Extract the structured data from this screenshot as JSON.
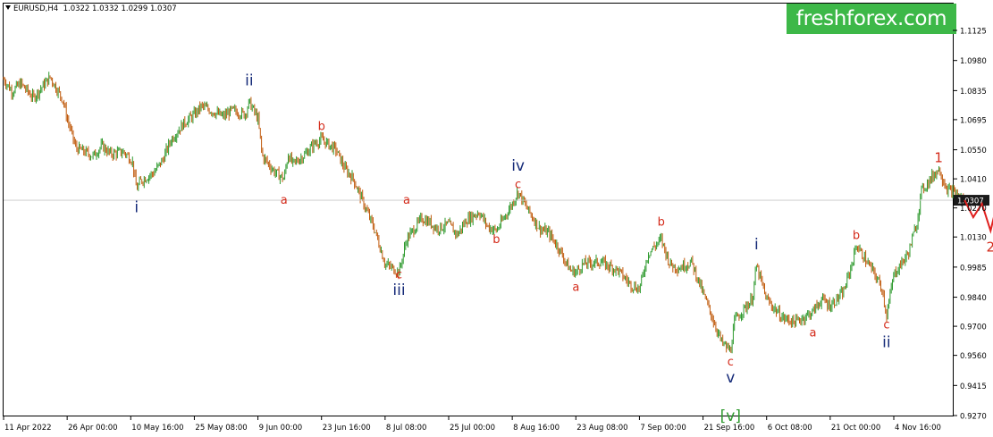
{
  "header": {
    "symbol": "EURUSD,H4",
    "ohlc": [
      "1.0322",
      "1.0332",
      "1.0299",
      "1.0307"
    ]
  },
  "brand": {
    "logo_text": "freshforex.com",
    "logo_bg": "#3db848"
  },
  "colors": {
    "bull_candle": "#2e9a2e",
    "bear_candle": "#c05a0c",
    "wave_label_red": "#d42a1a",
    "wave_label_blue": "#152a78",
    "forecast_line": "#e0201e",
    "price_tag_bg": "#1a1a1a"
  },
  "chart_data": {
    "type": "candlestick",
    "instrument": "EURUSD",
    "timeframe": "H4",
    "current_price": 1.0307,
    "current_price_label": "1.0307",
    "ylim": [
      0.9255,
      1.12
    ],
    "y_ticks": [
      {
        "value": 1.1125,
        "label": "1.1125"
      },
      {
        "value": 1.098,
        "label": "1.0980"
      },
      {
        "value": 1.0835,
        "label": "1.0835"
      },
      {
        "value": 1.0695,
        "label": "1.0695"
      },
      {
        "value": 1.055,
        "label": "1.0550"
      },
      {
        "value": 1.041,
        "label": "1.0410"
      },
      {
        "value": 1.027,
        "label": "1.0270"
      },
      {
        "value": 1.013,
        "label": "1.0130"
      },
      {
        "value": 0.9985,
        "label": "0.9985"
      },
      {
        "value": 0.984,
        "label": "0.9840"
      },
      {
        "value": 0.97,
        "label": "0.9700"
      },
      {
        "value": 0.956,
        "label": "0.9560"
      },
      {
        "value": 0.9415,
        "label": "0.9415"
      },
      {
        "value": 0.927,
        "label": "0.9270"
      }
    ],
    "x_ticks": [
      "11 Apr 2022",
      "26 Apr 00:00",
      "10 May 16:00",
      "25 May 08:00",
      "9 Jun 00:00",
      "23 Jun 16:00",
      "8 Jul 08:00",
      "25 Jul 00:00",
      "8 Aug 16:00",
      "23 Aug 08:00",
      "7 Sep 00:00",
      "21 Sep 16:00",
      "6 Oct 08:00",
      "21 Oct 00:00",
      "4 Nov 16:00"
    ],
    "price_path": [
      [
        "11 Apr 2022",
        1.089
      ],
      [
        "13 Apr",
        1.083
      ],
      [
        "15 Apr",
        1.087
      ],
      [
        "18 Apr",
        1.08
      ],
      [
        "20 Apr",
        1.085
      ],
      [
        "22 Apr",
        1.09
      ],
      [
        "25 Apr",
        1.079
      ],
      [
        "26 Apr 00:00",
        1.07
      ],
      [
        "28 Apr",
        1.056
      ],
      [
        "2 May",
        1.052
      ],
      [
        "4 May",
        1.057
      ],
      [
        "6 May",
        1.053
      ],
      [
        "9 May",
        1.054
      ],
      [
        "11 May",
        1.05
      ],
      [
        "12 May",
        1.036
      ],
      [
        "13 May",
        1.04
      ],
      [
        "16 May",
        1.044
      ],
      [
        "18 May",
        1.05
      ],
      [
        "20 May",
        1.06
      ],
      [
        "23 May",
        1.068
      ],
      [
        "25 May 08:00",
        1.072
      ],
      [
        "27 May",
        1.076
      ],
      [
        "30 May",
        1.073
      ],
      [
        "1 Jun",
        1.071
      ],
      [
        "3 Jun",
        1.074
      ],
      [
        "6 Jun",
        1.072
      ],
      [
        "7 Jun",
        1.078
      ],
      [
        "9 Jun 00:00",
        1.07
      ],
      [
        "10 Jun",
        1.052
      ],
      [
        "13 Jun",
        1.044
      ],
      [
        "15 Jun",
        1.041
      ],
      [
        "16 Jun",
        1.053
      ],
      [
        "17 Jun",
        1.048
      ],
      [
        "20 Jun",
        1.053
      ],
      [
        "22 Jun",
        1.058
      ],
      [
        "23 Jun 16:00",
        1.06
      ],
      [
        "27 Jun",
        1.055
      ],
      [
        "29 Jun",
        1.046
      ],
      [
        "1 Jul",
        1.041
      ],
      [
        "4 Jul",
        1.026
      ],
      [
        "6 Jul",
        1.016
      ],
      [
        "8 Jul 08:00",
        1.0
      ],
      [
        "12 Jul",
        0.996
      ],
      [
        "14 Jul",
        1.012
      ],
      [
        "18 Jul",
        1.022
      ],
      [
        "20 Jul",
        1.02
      ],
      [
        "22 Jul",
        1.017
      ],
      [
        "25 Jul 00:00",
        1.019
      ],
      [
        "27 Jul",
        1.014
      ],
      [
        "29 Jul",
        1.021
      ],
      [
        "1 Aug",
        1.025
      ],
      [
        "3 Aug",
        1.018
      ],
      [
        "5 Aug",
        1.016
      ],
      [
        "8 Aug 16:00",
        1.029
      ],
      [
        "10 Aug",
        1.035
      ],
      [
        "12 Aug",
        1.027
      ],
      [
        "15 Aug",
        1.017
      ],
      [
        "17 Aug",
        1.015
      ],
      [
        "19 Aug",
        1.009
      ],
      [
        "22 Aug",
        0.997
      ],
      [
        "23 Aug 08:00",
        0.996
      ],
      [
        "25 Aug",
        1.0
      ],
      [
        "29 Aug",
        1.001
      ],
      [
        "31 Aug",
        0.999
      ],
      [
        "2 Sep",
        0.997
      ],
      [
        "5 Sep",
        0.99
      ],
      [
        "7 Sep 00:00",
        0.988
      ],
      [
        "9 Sep",
        1.005
      ],
      [
        "12 Sep",
        1.012
      ],
      [
        "14 Sep",
        1.0
      ],
      [
        "16 Sep",
        0.998
      ],
      [
        "19 Sep",
        1.001
      ],
      [
        "21 Sep 16:00",
        0.986
      ],
      [
        "26 Sep",
        0.962
      ],
      [
        "28 Sep",
        0.958
      ],
      [
        "29 Sep",
        0.973
      ],
      [
        "3 Oct",
        0.983
      ],
      [
        "4 Oct",
        0.999
      ],
      [
        "6 Oct 08:00",
        0.983
      ],
      [
        "10 Oct",
        0.974
      ],
      [
        "13 Oct",
        0.972
      ],
      [
        "17 Oct",
        0.977
      ],
      [
        "19 Oct",
        0.983
      ],
      [
        "21 Oct 00:00",
        0.98
      ],
      [
        "24 Oct",
        0.986
      ],
      [
        "26 Oct",
        1.0
      ],
      [
        "27 Oct",
        1.009
      ],
      [
        "31 Oct",
        0.996
      ],
      [
        "2 Nov",
        0.988
      ],
      [
        "3 Nov",
        0.975
      ],
      [
        "4 Nov 16:00",
        0.995
      ],
      [
        "8 Nov",
        1.005
      ],
      [
        "10 Nov",
        1.02
      ],
      [
        "11 Nov",
        1.035
      ],
      [
        "15 Nov",
        1.046
      ],
      [
        "17 Nov",
        1.036
      ],
      [
        "18 Nov",
        1.035
      ],
      [
        "21 Nov",
        1.0307
      ]
    ],
    "forecast_path": [
      [
        "21 Nov",
        1.0307
      ],
      [
        "23 Nov",
        1.0225
      ],
      [
        "25 Nov",
        1.029
      ],
      [
        "27 Nov",
        1.016
      ],
      [
        "3 Dec",
        1.068
      ]
    ],
    "wave_labels": [
      {
        "text": "i",
        "color": "blue",
        "anchor_date": "12 May",
        "price": 1.025
      },
      {
        "text": "ii",
        "color": "blue",
        "anchor_date": "7 Jun",
        "price": 1.086
      },
      {
        "text": "a",
        "color": "red",
        "anchor_date": "15 Jun",
        "price": 1.029
      },
      {
        "text": "b",
        "color": "red",
        "anchor_date": "23 Jun 16:00",
        "price": 1.0645
      },
      {
        "text": "c",
        "color": "red",
        "anchor_date": "12 Jul",
        "price": 0.993
      },
      {
        "text": "iii",
        "color": "blue",
        "anchor_date": "12 Jul",
        "price": 0.985
      },
      {
        "text": "a",
        "color": "red",
        "anchor_date": "14 Jul",
        "price": 1.029
      },
      {
        "text": "b",
        "color": "red",
        "anchor_date": "5 Aug",
        "price": 1.01
      },
      {
        "text": "iv",
        "color": "blue",
        "anchor_date": "10 Aug",
        "price": 1.045
      },
      {
        "text": "c",
        "color": "red",
        "anchor_date": "10 Aug",
        "price": 1.0365
      },
      {
        "text": "a",
        "color": "red",
        "anchor_date": "23 Aug 08:00",
        "price": 0.987
      },
      {
        "text": "b",
        "color": "red",
        "anchor_date": "12 Sep",
        "price": 1.0185
      },
      {
        "text": "i",
        "color": "blue",
        "anchor_date": "4 Oct",
        "price": 1.007
      },
      {
        "text": "c",
        "color": "red",
        "anchor_date": "28 Sep",
        "price": 0.951
      },
      {
        "text": "v",
        "color": "blue",
        "anchor_date": "28 Sep",
        "price": 0.943
      },
      {
        "text": "[v]",
        "color": "green",
        "anchor_date": "28 Sep",
        "price": 0.9245
      },
      {
        "text": "a",
        "color": "red",
        "anchor_date": "17 Oct",
        "price": 0.965
      },
      {
        "text": "b",
        "color": "red",
        "anchor_date": "27 Oct",
        "price": 1.012
      },
      {
        "text": "c",
        "color": "red",
        "anchor_date": "3 Nov",
        "price": 0.969
      },
      {
        "text": "ii",
        "color": "blue",
        "anchor_date": "3 Nov",
        "price": 0.96
      },
      {
        "text": "1",
        "color": "red",
        "anchor_date": "15 Nov",
        "price": 1.049
      },
      {
        "text": "2",
        "color": "red",
        "anchor_date": "27 Nov",
        "price": 1.006
      }
    ]
  }
}
